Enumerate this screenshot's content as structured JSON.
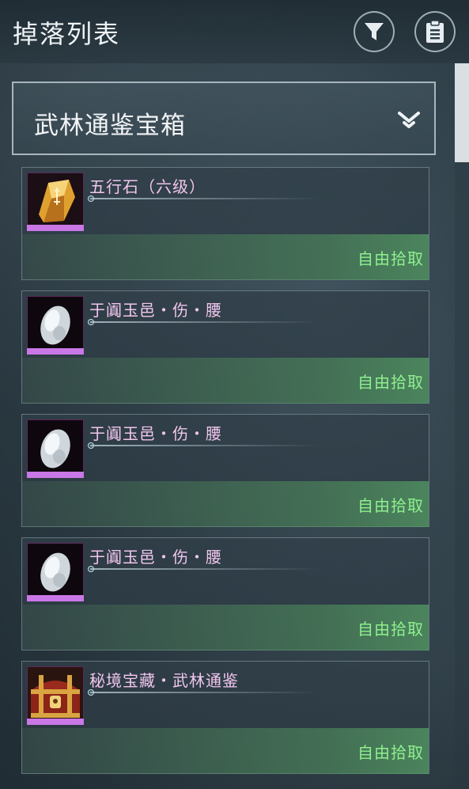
{
  "header": {
    "title": "掉落列表"
  },
  "dropdown": {
    "selected": "武林通鉴宝箱"
  },
  "items": [
    {
      "name": "五行石（六级）",
      "action": "自由拾取",
      "icon": "yellow-gem-stone-icon"
    },
    {
      "name": "于阗玉邑・伤・腰",
      "action": "自由拾取",
      "icon": "white-jade-icon"
    },
    {
      "name": "于阗玉邑・伤・腰",
      "action": "自由拾取",
      "icon": "white-jade-icon"
    },
    {
      "name": "于阗玉邑・伤・腰",
      "action": "自由拾取",
      "icon": "white-jade-icon"
    },
    {
      "name": "秘境宝藏・武林通鉴",
      "action": "自由拾取",
      "icon": "treasure-chest-icon"
    }
  ],
  "colors": {
    "item_name": "#f2c6ee",
    "action_text": "#8ff08f",
    "rarity_bar": "#c977e6"
  }
}
